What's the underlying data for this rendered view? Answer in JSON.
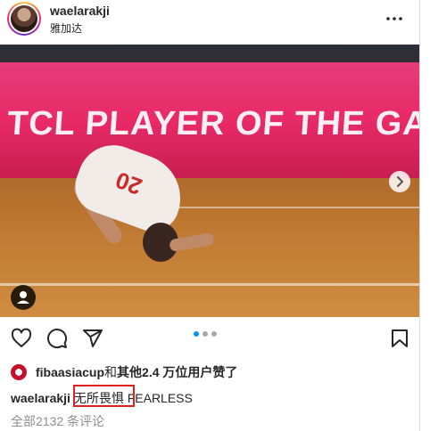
{
  "post": {
    "username": "waelarakji",
    "location": "雅加达",
    "photo": {
      "banner_text": "TCL PLAYER OF THE GAME",
      "jersey_number": "20"
    },
    "carousel": {
      "total": 3,
      "active": 1
    },
    "likes": {
      "account": "fibaasiacup",
      "connector": "和",
      "others": "其他2.4 万位用户",
      "suffix": "赞了"
    },
    "caption": {
      "username": "waelarakji",
      "text": "无所畏惧",
      "text_en": " FEARLESS"
    },
    "comments_link": "全部2132 条评论"
  },
  "colors": {
    "accent": "#0095f6",
    "highlight": "#e02020",
    "banner": "#e82a66"
  },
  "icons": [
    "more-horizontal-icon",
    "user-tag-icon",
    "chevron-right-icon",
    "heart-icon",
    "comment-icon",
    "share-icon",
    "bookmark-icon"
  ]
}
